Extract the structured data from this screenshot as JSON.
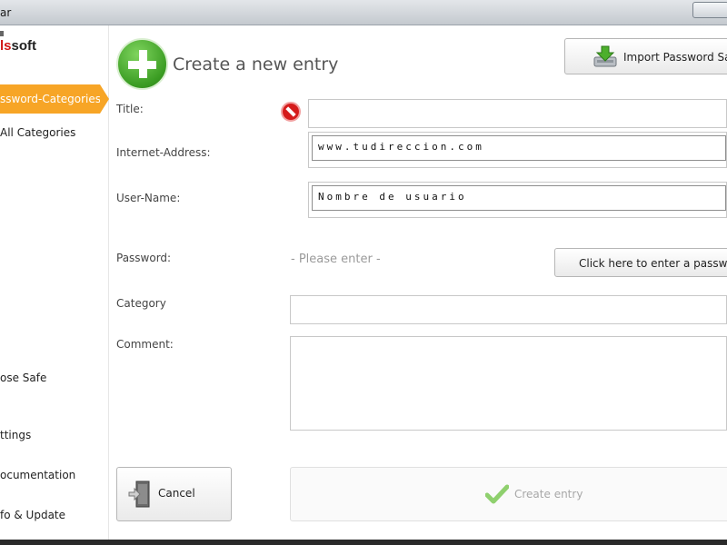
{
  "window": {
    "title": "ar"
  },
  "logo": {
    "prefix": "l",
    "brand": "ls",
    "suffix": "soft"
  },
  "sidebar": {
    "active_item": "ssword-Categories",
    "items": [
      {
        "label": "All Categories"
      },
      {
        "label": "ose Safe"
      },
      {
        "label": "ttings"
      },
      {
        "label": "ocumentation"
      },
      {
        "label": "fo & Update"
      }
    ]
  },
  "main": {
    "heading": "Create a new entry",
    "import_label": "Import Password Sa",
    "labels": {
      "title": "Title:",
      "internet_address": "Internet-Address:",
      "user_name": "User-Name:",
      "password": "Password:",
      "category": "Category",
      "comment": "Comment:"
    },
    "fields": {
      "internet_address": "www.tudireccion.com",
      "user_name": "Nombre de usuario"
    },
    "password_placeholder": "- Please enter -",
    "password_button": "Click here to enter a passwo",
    "cancel_label": "Cancel",
    "create_label": "Create entry"
  },
  "colors": {
    "accent": "#f7a526",
    "add_green": "#3a9c22",
    "error_red": "#d51b1b"
  }
}
